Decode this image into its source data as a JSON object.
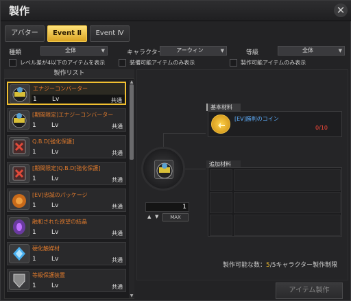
{
  "window": {
    "title": "製作",
    "close_label": "✕"
  },
  "tabs": [
    {
      "label": "アバター",
      "active": false
    },
    {
      "label": "Event Ⅱ",
      "active": true
    },
    {
      "label": "Event Ⅳ",
      "active": false
    }
  ],
  "filters": {
    "type_label": "種類",
    "type_value": "全体",
    "character_label": "キャラクター",
    "character_value": "アーウィン",
    "grade_label": "等級",
    "grade_value": "全体",
    "chk_level_label": "レベル差が4以下のアイテムを表示",
    "chk_equip_label": "装備可能アイテムのみ表示",
    "chk_craft_label": "製作可能アイテムのみ表示"
  },
  "list": {
    "header": "製作リスト",
    "items": [
      {
        "name": "エナジーコンバーター",
        "level": "1",
        "lv": "Lv",
        "shared": "共通",
        "active": true,
        "icon": "energy-converter-icon"
      },
      {
        "name": "[期間限定]エナジーコンバーター",
        "level": "1",
        "lv": "Lv",
        "shared": "共通",
        "active": false,
        "icon": "energy-converter-icon"
      },
      {
        "name": "Q.B.D[強化保護]",
        "level": "1",
        "lv": "Lv",
        "shared": "共通",
        "active": false,
        "icon": "qbd-icon"
      },
      {
        "name": "[期間限定]Q.B.D[強化保護]",
        "level": "1",
        "lv": "Lv",
        "shared": "共通",
        "active": false,
        "icon": "qbd-icon"
      },
      {
        "name": "[EV]忠誠のパッケージ",
        "level": "1",
        "lv": "Lv",
        "shared": "共通",
        "active": false,
        "icon": "package-icon"
      },
      {
        "name": "融和された欲望の結晶",
        "level": "1",
        "lv": "Lv",
        "shared": "共通",
        "active": false,
        "icon": "crystal-icon"
      },
      {
        "name": "硬化触媒材",
        "level": "1",
        "lv": "Lv",
        "shared": "共通",
        "active": false,
        "icon": "catalyst-icon"
      },
      {
        "name": "等級保護装置",
        "level": "1",
        "lv": "Lv",
        "shared": "共通",
        "active": false,
        "icon": "protector-icon"
      }
    ]
  },
  "craft": {
    "quantity": "1",
    "max_label": "MAX",
    "basic_header": "基本材料",
    "material_name": "[EV]勝利のコイン",
    "material_count": "0/10",
    "extra_header": "追加材料",
    "info_prefix": "製作可能な数：",
    "info_num": "5",
    "info_suffix": "/5キャラクター製作制限",
    "button_label": "アイテム製作"
  },
  "colors": {
    "accent": "#f2c031",
    "item_name": "#e07a2c",
    "material_name": "#5fb0ff",
    "count_red": "#ff4a3a"
  }
}
